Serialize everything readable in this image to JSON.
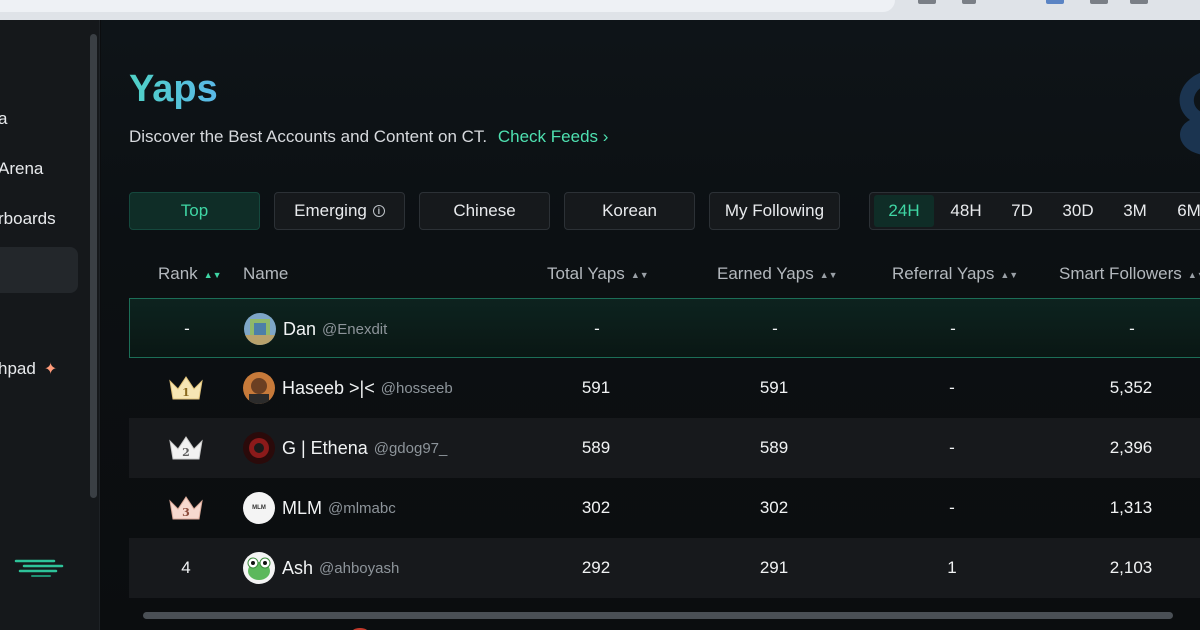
{
  "sidebar": {
    "items": [
      {
        "label": "a"
      },
      {
        "label": "Arena"
      },
      {
        "label": "rboards"
      },
      {
        "label": ""
      },
      {
        "label": "hpad"
      }
    ],
    "sparkle_icon": "sparkle-icon"
  },
  "header": {
    "title": "Yaps",
    "subtitle": "Discover the Best Accounts and Content on CT.",
    "link": "Check Feeds"
  },
  "tabs": [
    {
      "label": "Top",
      "active": true
    },
    {
      "label": "Emerging",
      "icon": "info-icon"
    },
    {
      "label": "Chinese"
    },
    {
      "label": "Korean"
    },
    {
      "label": "My Following"
    }
  ],
  "periods": [
    {
      "label": "24H",
      "active": true
    },
    {
      "label": "48H"
    },
    {
      "label": "7D"
    },
    {
      "label": "30D"
    },
    {
      "label": "3M"
    },
    {
      "label": "6M"
    }
  ],
  "columns": {
    "rank": "Rank",
    "name": "Name",
    "total": "Total Yaps",
    "earned": "Earned Yaps",
    "referral": "Referral Yaps",
    "smart": "Smart Followers"
  },
  "rows": [
    {
      "rank": "-",
      "name": "Dan",
      "handle": "@Enexdit",
      "total": "-",
      "earned": "-",
      "referral": "-",
      "smart": "-"
    },
    {
      "rank": "1",
      "name": "Haseeb >|<",
      "handle": "@hosseeb",
      "total": "591",
      "earned": "591",
      "referral": "-",
      "smart": "5,352"
    },
    {
      "rank": "2",
      "name": "G | Ethena",
      "handle": "@gdog97_",
      "total": "589",
      "earned": "589",
      "referral": "-",
      "smart": "2,396"
    },
    {
      "rank": "3",
      "name": "MLM",
      "handle": "@mlmabc",
      "total": "302",
      "earned": "302",
      "referral": "-",
      "smart": "1,313"
    },
    {
      "rank": "4",
      "name": "Ash",
      "handle": "@ahboyash",
      "total": "292",
      "earned": "291",
      "referral": "1",
      "smart": "2,103"
    }
  ],
  "avatar_texts": {
    "mlm": "MLM"
  },
  "colors": {
    "accent": "#3fd6a4",
    "title_gradient_start": "#4fd1c5",
    "title_gradient_end": "#5ab8e8"
  }
}
